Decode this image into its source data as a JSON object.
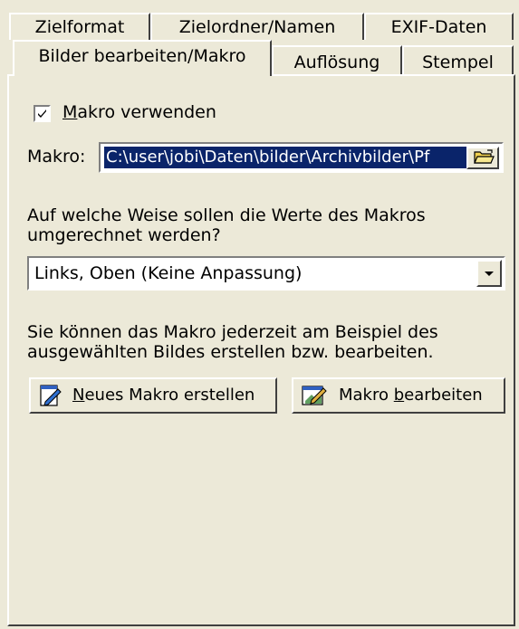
{
  "tabs_back": [
    {
      "label": "Zielformat"
    },
    {
      "label": "Zielordner/Namen"
    },
    {
      "label": "EXIF-Daten"
    }
  ],
  "tabs_front": [
    {
      "label": "Bilder bearbeiten/Makro",
      "selected": true
    },
    {
      "label": "Auflösung"
    },
    {
      "label": "Stempel"
    }
  ],
  "macro_checkbox": {
    "label_accel": "M",
    "label_rest": "akro verwenden",
    "checked": true
  },
  "macro_field": {
    "label": "Makro:",
    "value": "C:\\user\\jobi\\Daten\\bilder\\Archivbilder\\Pf"
  },
  "question": {
    "line1": "Auf welche Weise sollen die Werte des Makros",
    "line2": "umgerechnet werden?"
  },
  "mode_select": {
    "value": "Links, Oben (Keine Anpassung)"
  },
  "info": {
    "line1": "Sie können das Makro jederzeit am Beispiel des",
    "line2": "ausgewählten Bildes erstellen bzw. bearbeiten."
  },
  "buttons": {
    "new_accel": "N",
    "new_rest": "eues Makro erstellen",
    "edit_pre": "Makro ",
    "edit_accel": "b",
    "edit_rest": "earbeiten"
  },
  "colors": {
    "face": "#ece9d8",
    "selection": "#0a246a",
    "folder": "#f0d050"
  }
}
